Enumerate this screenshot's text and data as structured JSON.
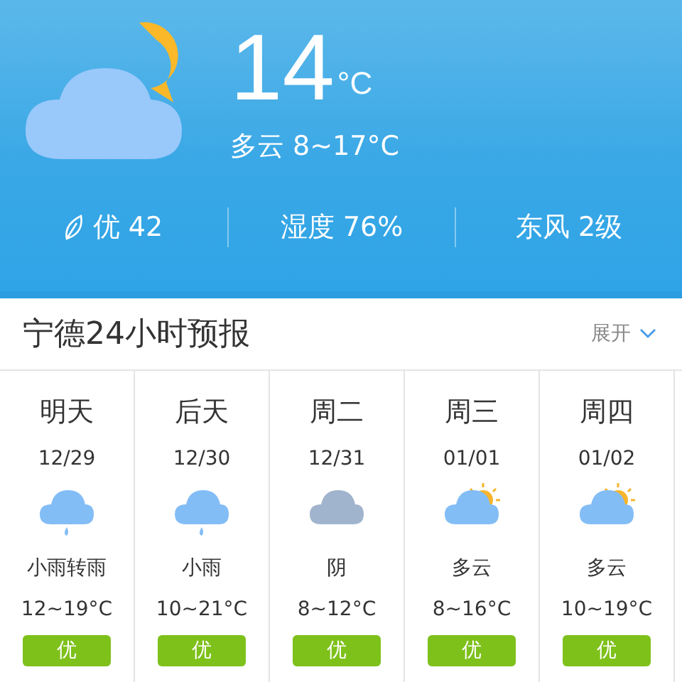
{
  "current": {
    "kind": "cloud-moon",
    "temperature": "14",
    "unit": "°C",
    "summary": "多云 8~17°C"
  },
  "stats": [
    {
      "kind": "air",
      "text": "优 42"
    },
    {
      "kind": "plain",
      "text": "湿度 76%"
    },
    {
      "kind": "plain",
      "text": "东风 2级"
    }
  ],
  "forecast_header": {
    "title": "宁德24小时预报",
    "toggle": "展开"
  },
  "days": [
    {
      "day": "明天",
      "date": "12/29",
      "kind": "rain",
      "weather": "小雨转雨",
      "temps": "12~19°C",
      "aqi": "优"
    },
    {
      "day": "后天",
      "date": "12/30",
      "kind": "rain",
      "weather": "小雨",
      "temps": "10~21°C",
      "aqi": "优"
    },
    {
      "day": "周二",
      "date": "12/31",
      "kind": "overcast",
      "weather": "阴",
      "temps": "8~12°C",
      "aqi": "优"
    },
    {
      "day": "周三",
      "date": "01/01",
      "kind": "partly-cloudy",
      "weather": "多云",
      "temps": "8~16°C",
      "aqi": "优"
    },
    {
      "day": "周四",
      "date": "01/02",
      "kind": "partly-cloudy",
      "weather": "多云",
      "temps": "10~19°C",
      "aqi": "优"
    }
  ]
}
